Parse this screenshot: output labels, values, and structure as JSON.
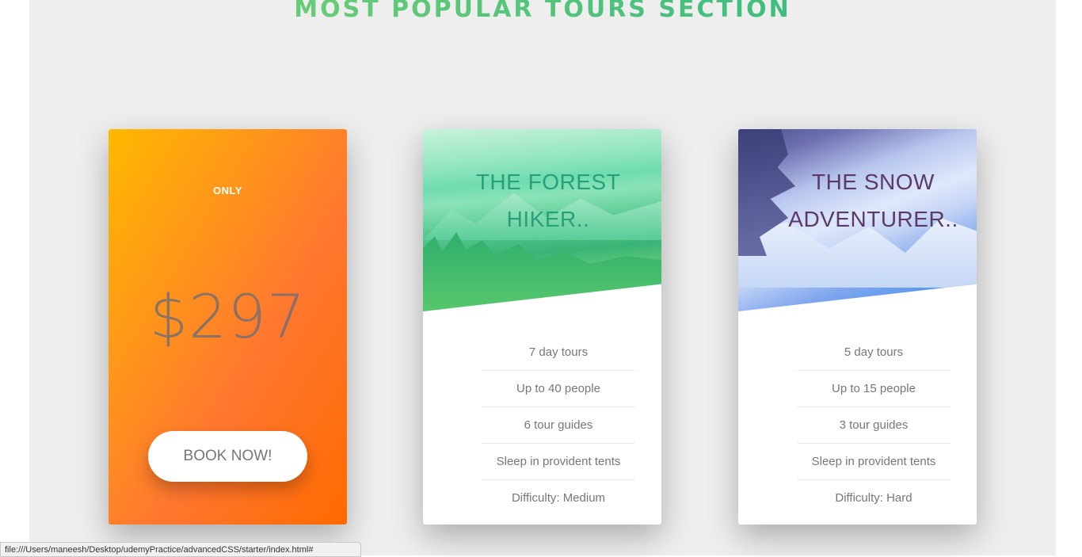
{
  "section": {
    "heading": "MOST POPULAR TOURS SECTION"
  },
  "cards": [
    {
      "label_only": "ONLY",
      "price": "$297",
      "cta": "BOOK NOW!"
    },
    {
      "title_line1": "THE FOREST",
      "title_line2": "HIKER..",
      "details": [
        "7 day tours",
        "Up to 40 people",
        "6 tour guides",
        "Sleep in provident tents",
        "Difficulty: Medium"
      ]
    },
    {
      "title_line1": "THE SNOW",
      "title_line2": "ADVENTURER..",
      "details": [
        "5 day tours",
        "Up to 15 people",
        "3 tour guides",
        "Sleep in provident tents",
        "Difficulty: Hard"
      ]
    }
  ],
  "status_bar": {
    "url": "file:///Users/maneesh/Desktop/udemyPractice/advancedCSS/starter/index.html#"
  },
  "colors": {
    "heading_gradient_start": "#7ed56f",
    "heading_gradient_end": "#28b485",
    "orange_gradient_start": "#ffb900",
    "orange_gradient_end": "#ff7730"
  }
}
